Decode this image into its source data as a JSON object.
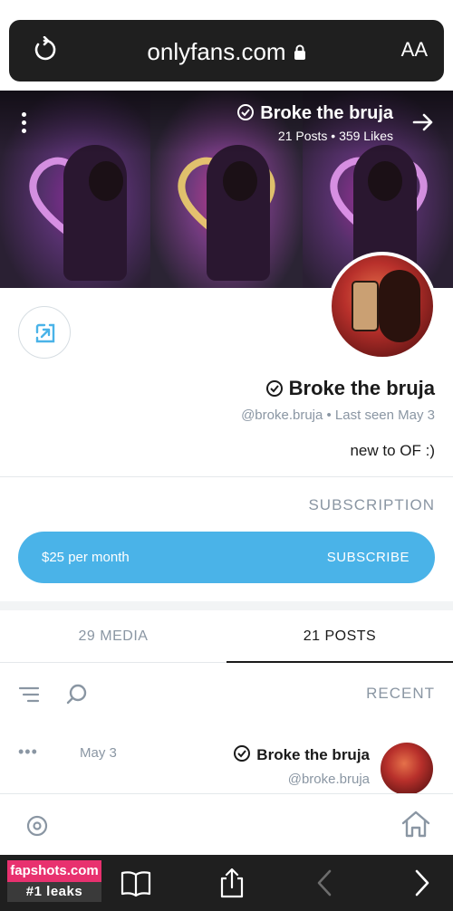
{
  "browser": {
    "url": "onlyfans.com",
    "text_size_label": "AA",
    "reload_icon": "reload-icon",
    "lock_icon": "lock-icon"
  },
  "banner": {
    "title": "Broke the bruja",
    "stats": "21 Posts  •  359 Likes",
    "menu_icon": "kebab-icon",
    "arrow_icon": "arrow-right-icon"
  },
  "profile": {
    "name": "Broke the bruja",
    "handle_line": "@broke.bruja  •  Last seen May 3",
    "bio": "new to OF :)",
    "share_icon": "share-icon",
    "verified_icon": "verified-badge-icon"
  },
  "subscription": {
    "label": "SUBSCRIPTION",
    "button_label": "SUBSCRIBE",
    "price": "$25 per month"
  },
  "tabs": [
    {
      "label": "21 POSTS",
      "active": true
    },
    {
      "label": "29 MEDIA",
      "active": false
    }
  ],
  "feed": {
    "section_label": "RECENT",
    "filter_icon": "filter-icon",
    "search_icon": "search-icon",
    "post": {
      "author": "Broke the bruja",
      "handle": "@broke.bruja",
      "date": "May 3",
      "more_label": "•••"
    }
  },
  "app_nav": {
    "home_icon": "home-icon",
    "profile_icon": "circle-profile-icon"
  },
  "watermark": {
    "site": "fapshots.com",
    "tagline": "#1 leaks"
  },
  "safari_toolbar": {
    "icons": [
      "bookmarks-icon",
      "share-icon",
      "back-icon",
      "forward-icon"
    ]
  },
  "colors": {
    "accent": "#4ab3e8",
    "muted_text": "#8a96a3",
    "watermark_pink": "#e8316f",
    "toolbar_dark": "#1f1f1f"
  }
}
